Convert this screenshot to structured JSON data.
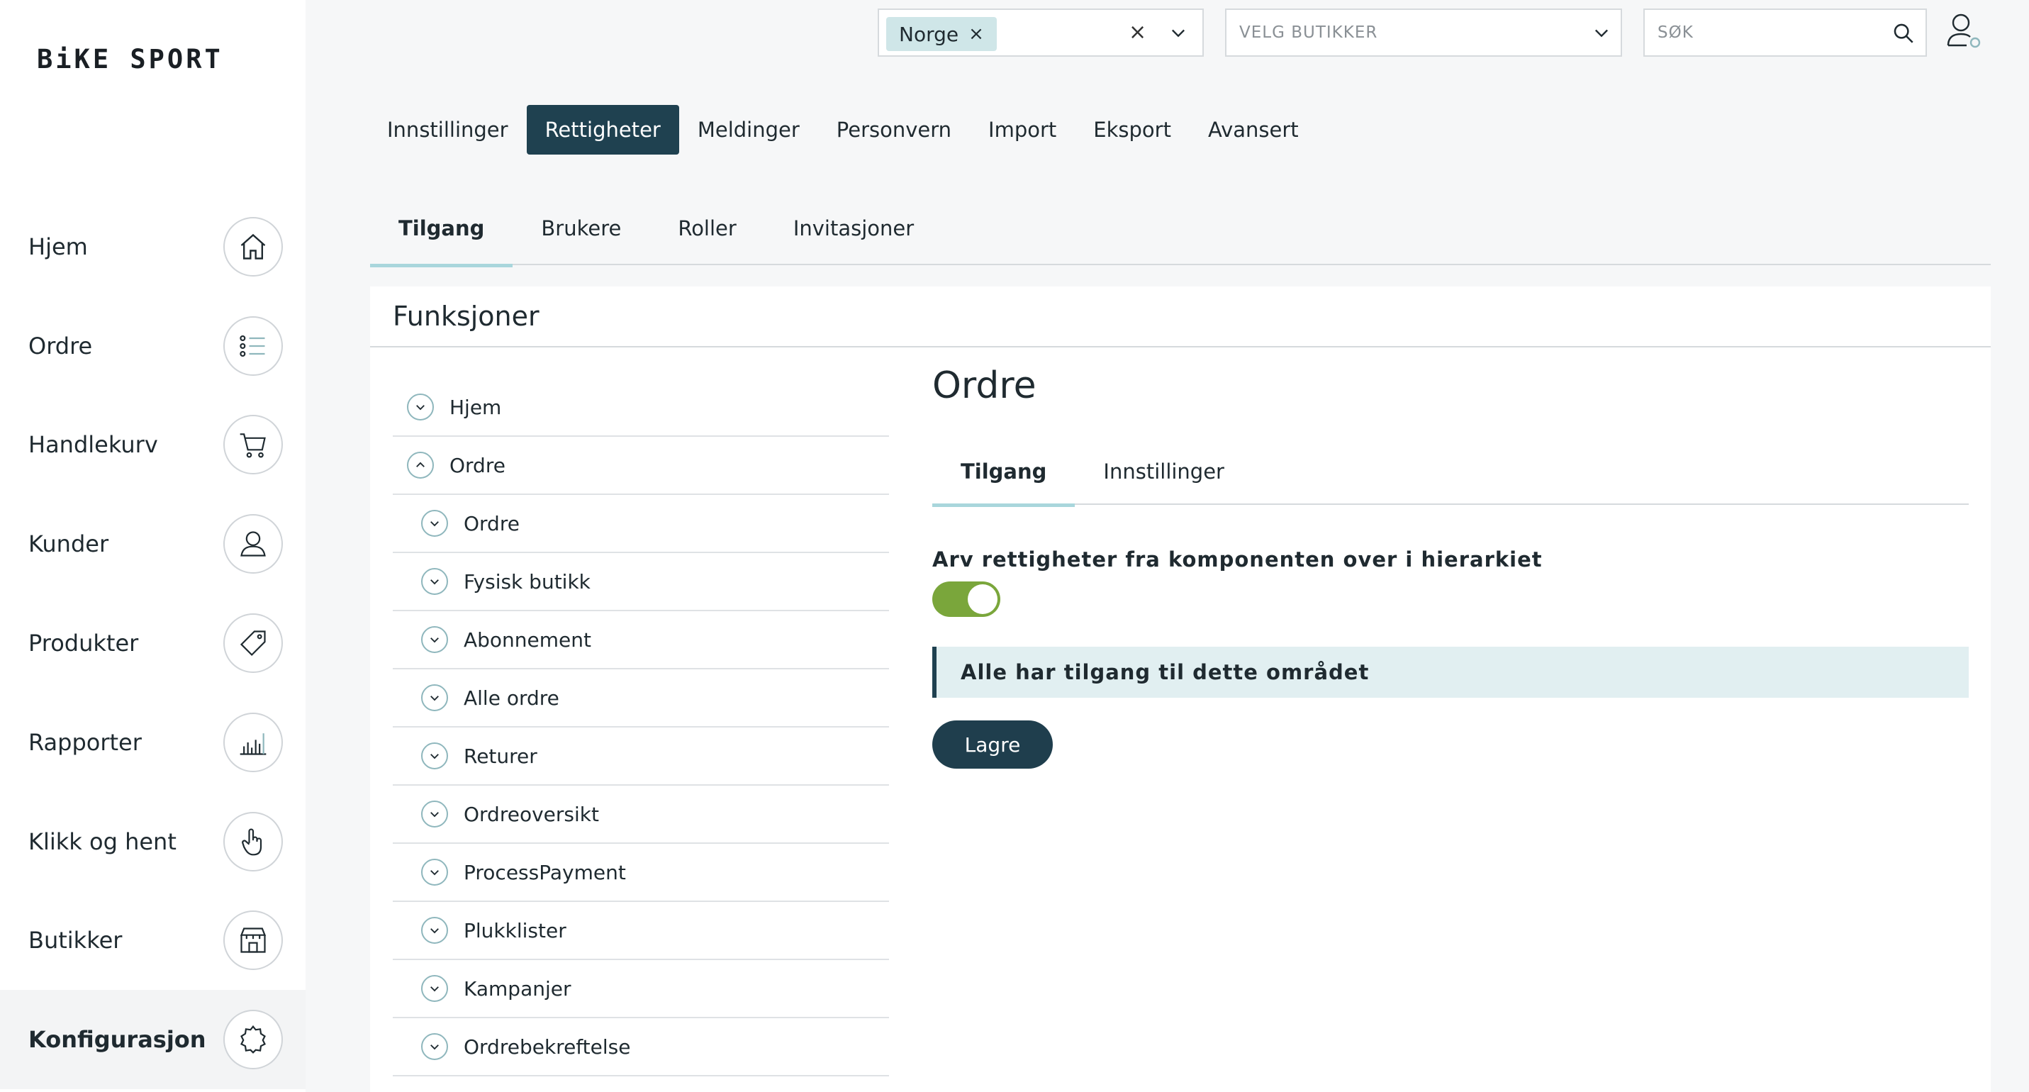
{
  "app": {
    "logo": "BiKE SPORT"
  },
  "sidebar": {
    "items": [
      {
        "label": "Hjem",
        "icon": "home-icon"
      },
      {
        "label": "Ordre",
        "icon": "list-icon"
      },
      {
        "label": "Handlekurv",
        "icon": "cart-icon"
      },
      {
        "label": "Kunder",
        "icon": "customer-icon"
      },
      {
        "label": "Produkter",
        "icon": "tag-icon"
      },
      {
        "label": "Rapporter",
        "icon": "chart-icon"
      },
      {
        "label": "Klikk og hent",
        "icon": "hand-pointer-icon"
      },
      {
        "label": "Butikker",
        "icon": "store-icon"
      },
      {
        "label": "Konfigurasjon",
        "icon": "gear-icon",
        "active": true
      }
    ]
  },
  "topbar": {
    "country_chip": "Norge",
    "chip_remove": "×",
    "clear": "×",
    "store_placeholder": "VELG BUTIKKER",
    "search_placeholder": "SØK"
  },
  "primary_tabs": [
    "Innstillinger",
    "Rettigheter",
    "Meldinger",
    "Personvern",
    "Import",
    "Eksport",
    "Avansert"
  ],
  "primary_active": "Rettigheter",
  "secondary_tabs": [
    "Tilgang",
    "Brukere",
    "Roller",
    "Invitasjoner"
  ],
  "panel": {
    "title": "Funksjoner",
    "tree": [
      {
        "label": "Hjem",
        "level": 0,
        "expanded": false
      },
      {
        "label": "Ordre",
        "level": 0,
        "expanded": true
      },
      {
        "label": "Ordre",
        "level": 1,
        "expanded": false
      },
      {
        "label": "Fysisk butikk",
        "level": 1,
        "expanded": false
      },
      {
        "label": "Abonnement",
        "level": 1,
        "expanded": false
      },
      {
        "label": "Alle ordre",
        "level": 1,
        "expanded": false
      },
      {
        "label": "Returer",
        "level": 1,
        "expanded": false
      },
      {
        "label": "Ordreoversikt",
        "level": 1,
        "expanded": false
      },
      {
        "label": "ProcessPayment",
        "level": 1,
        "expanded": false
      },
      {
        "label": "Plukklister",
        "level": 1,
        "expanded": false
      },
      {
        "label": "Kampanjer",
        "level": 1,
        "expanded": false
      },
      {
        "label": "Ordrebekreftelse",
        "level": 1,
        "expanded": false
      }
    ],
    "detail": {
      "title": "Ordre",
      "tabs": [
        "Tilgang",
        "Innstillinger"
      ],
      "inherit_label": "Arv rettigheter fra komponenten over i hierarkiet",
      "inherit_on": true,
      "notice": "Alle har tilgang til dette området",
      "save_label": "Lagre"
    }
  },
  "colors": {
    "accent": "#1f4150",
    "toggle_on": "#7aa63b",
    "tab_underline": "#a9d6dc",
    "chip_bg": "#cfe6e8"
  }
}
